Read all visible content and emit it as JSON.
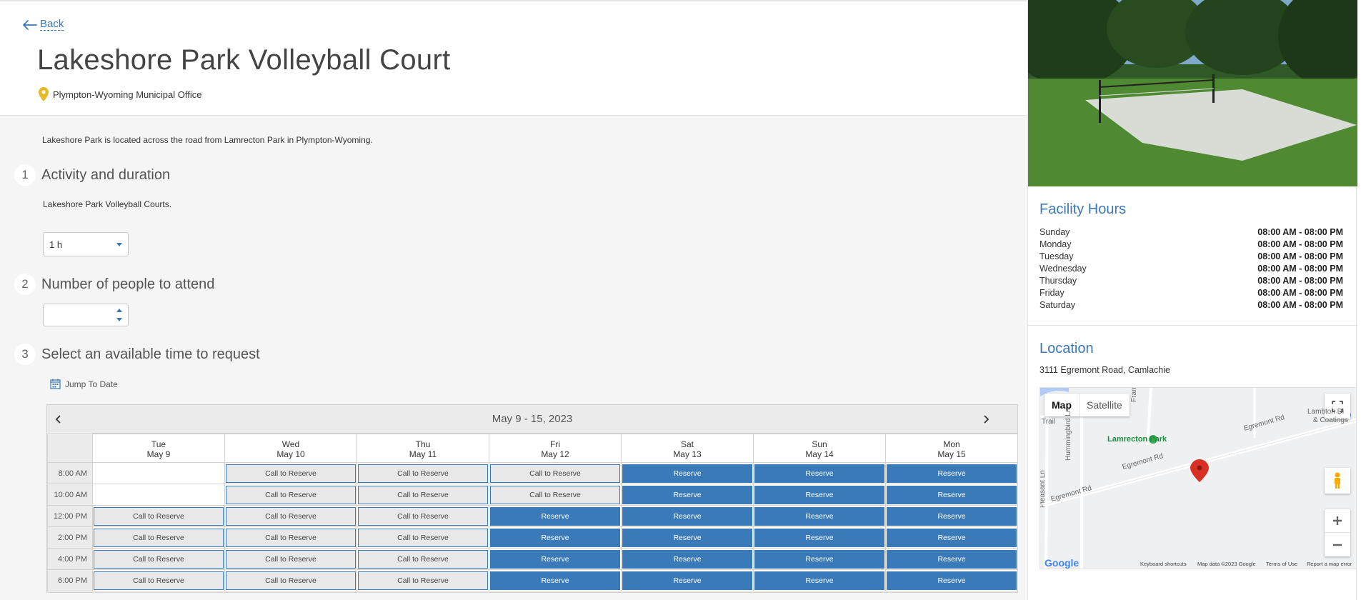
{
  "back_label": "Back",
  "page_title": "Lakeshore Park Volleyball Court",
  "location_name": "Plympton-Wyoming Municipal Office",
  "description": "Lakeshore Park is located across the road from Lamrecton Park in Plympton-Wyoming.",
  "steps": [
    {
      "num": "1",
      "label": "Activity and duration"
    },
    {
      "num": "2",
      "label": "Number of people to attend"
    },
    {
      "num": "3",
      "label": "Select an available time to request"
    }
  ],
  "activity_note": "Lakeshore Park Volleyball Courts.",
  "duration_value": "1 h",
  "people_value": "",
  "jump_label": "Jump To Date",
  "calendar": {
    "range_label": "May 9 - 15, 2023",
    "days": [
      {
        "dow": "Tue",
        "date": "May 9"
      },
      {
        "dow": "Wed",
        "date": "May 10"
      },
      {
        "dow": "Thu",
        "date": "May 11"
      },
      {
        "dow": "Fri",
        "date": "May 12"
      },
      {
        "dow": "Sat",
        "date": "May 13"
      },
      {
        "dow": "Sun",
        "date": "May 14"
      },
      {
        "dow": "Mon",
        "date": "May 15"
      }
    ],
    "rows": [
      {
        "time": "8:00 AM",
        "slots": [
          "",
          "Call to Reserve",
          "Call to Reserve",
          "Call to Reserve",
          "Reserve",
          "Reserve",
          "Reserve"
        ]
      },
      {
        "time": "10:00 AM",
        "slots": [
          "",
          "Call to Reserve",
          "Call to Reserve",
          "Call to Reserve",
          "Reserve",
          "Reserve",
          "Reserve"
        ]
      },
      {
        "time": "12:00 PM",
        "slots": [
          "Call to Reserve",
          "Call to Reserve",
          "Call to Reserve",
          "Reserve",
          "Reserve",
          "Reserve",
          "Reserve"
        ]
      },
      {
        "time": "2:00 PM",
        "slots": [
          "Call to Reserve",
          "Call to Reserve",
          "Call to Reserve",
          "Reserve",
          "Reserve",
          "Reserve",
          "Reserve"
        ]
      },
      {
        "time": "4:00 PM",
        "slots": [
          "Call to Reserve",
          "Call to Reserve",
          "Call to Reserve",
          "Reserve",
          "Reserve",
          "Reserve",
          "Reserve"
        ]
      },
      {
        "time": "6:00 PM",
        "slots": [
          "Call to Reserve",
          "Call to Reserve",
          "Call to Reserve",
          "Reserve",
          "Reserve",
          "Reserve",
          "Reserve"
        ]
      }
    ]
  },
  "sidebar": {
    "hours_title": "Facility Hours",
    "hours": [
      {
        "day": "Sunday",
        "time": "08:00 AM - 08:00 PM"
      },
      {
        "day": "Monday",
        "time": "08:00 AM - 08:00 PM"
      },
      {
        "day": "Tuesday",
        "time": "08:00 AM - 08:00 PM"
      },
      {
        "day": "Wednesday",
        "time": "08:00 AM - 08:00 PM"
      },
      {
        "day": "Thursday",
        "time": "08:00 AM - 08:00 PM"
      },
      {
        "day": "Friday",
        "time": "08:00 AM - 08:00 PM"
      },
      {
        "day": "Saturday",
        "time": "08:00 AM - 08:00 PM"
      }
    ],
    "location_title": "Location",
    "address": "3111 Egremont Road, Camlachie"
  },
  "map": {
    "map_label": "Map",
    "satellite_label": "Satellite",
    "park_label": "Lamrecton Park",
    "road_egremont": "Egremont Rd",
    "road_franklin": "Franklin Ave",
    "road_hummingbird": "Hummingbird Ln",
    "road_pleasant": "Pleasant Ln",
    "road_trail": "Trail",
    "business_label_1": "Lambton Di",
    "business_label_2": "& Coatings",
    "google_label": "Google",
    "footer": [
      "Keyboard shortcuts",
      "Map data ©2023 Google",
      "Terms of Use",
      "Report a map error"
    ]
  },
  "colors": {
    "accent": "#3a78b8",
    "reserve_bg": "#3a7ab8",
    "call_bg": "#e8e8e8",
    "marker": "#e8b923",
    "pin": "#d93025"
  }
}
